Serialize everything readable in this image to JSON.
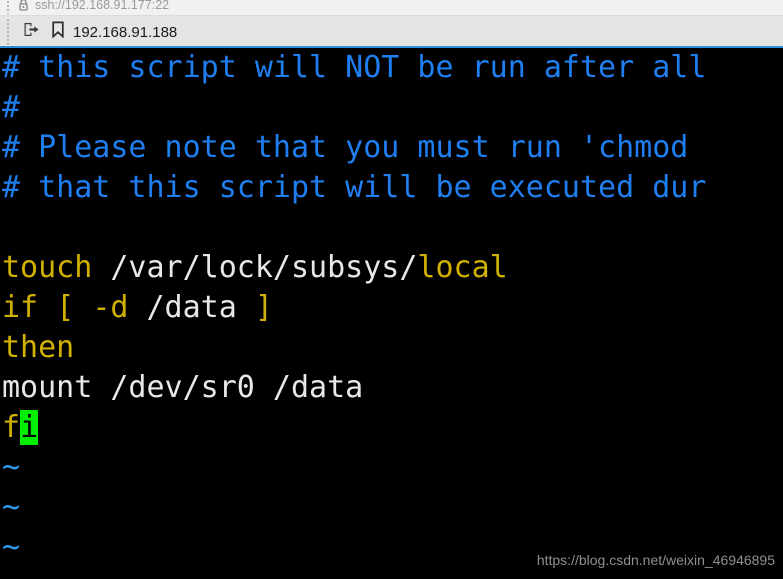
{
  "header": {
    "connection": {
      "icon": "lock-icon",
      "label": "ssh://192.168.91.177:22"
    },
    "bookmark": {
      "forward_icon": "forward-transfer-icon",
      "bookmark_icon": "bookmark-icon",
      "label": "192.168.91.188"
    },
    "accent_color": "#2d8fd5"
  },
  "terminal": {
    "background": "#000000",
    "colors": {
      "comment": "#1f7ef0",
      "keyword": "#d0b000",
      "plain": "#e8e8e8",
      "tilde": "#2e9bf0",
      "cursor_bg": "#00ef00",
      "cursor_fg": "#000000"
    },
    "lines": [
      {
        "name": "comment-line-1",
        "spans": [
          {
            "text": "# this script will NOT be run after all",
            "style": "comment"
          }
        ]
      },
      {
        "name": "comment-line-2",
        "spans": [
          {
            "text": "#",
            "style": "comment"
          }
        ]
      },
      {
        "name": "comment-line-3",
        "spans": [
          {
            "text": "# Please note that you must run 'chmod",
            "style": "comment"
          }
        ]
      },
      {
        "name": "comment-line-4",
        "spans": [
          {
            "text": "# that this script will be executed dur",
            "style": "comment"
          }
        ]
      },
      {
        "name": "blank-line-1",
        "spans": [
          {
            "text": "",
            "style": "plain"
          }
        ]
      },
      {
        "name": "command-line-touch",
        "spans": [
          {
            "text": "touch",
            "style": "keyword"
          },
          {
            "text": " /var/lock/subsys/",
            "style": "plain"
          },
          {
            "text": "local",
            "style": "keyword"
          }
        ]
      },
      {
        "name": "command-line-if",
        "spans": [
          {
            "text": "if",
            "style": "keyword"
          },
          {
            "text": " ",
            "style": "plain"
          },
          {
            "text": "[",
            "style": "keyword"
          },
          {
            "text": " ",
            "style": "plain"
          },
          {
            "text": "-d",
            "style": "keyword"
          },
          {
            "text": " /data ",
            "style": "plain"
          },
          {
            "text": "]",
            "style": "keyword"
          }
        ]
      },
      {
        "name": "command-line-then",
        "spans": [
          {
            "text": "then",
            "style": "keyword"
          }
        ]
      },
      {
        "name": "command-line-mount",
        "spans": [
          {
            "text": "mount /dev/sr0 /data",
            "style": "plain"
          }
        ]
      },
      {
        "name": "command-line-fi",
        "spans": [
          {
            "text": "f",
            "style": "keyword"
          },
          {
            "text": "i",
            "style": "cursor"
          }
        ]
      },
      {
        "name": "empty-marker-line-1",
        "spans": [
          {
            "text": "~",
            "style": "tilde"
          }
        ]
      },
      {
        "name": "empty-marker-line-2",
        "spans": [
          {
            "text": "~",
            "style": "tilde"
          }
        ]
      },
      {
        "name": "empty-marker-line-3",
        "spans": [
          {
            "text": "~",
            "style": "tilde"
          }
        ]
      }
    ]
  },
  "watermark": {
    "text": "https://blog.csdn.net/weixin_46946895"
  }
}
